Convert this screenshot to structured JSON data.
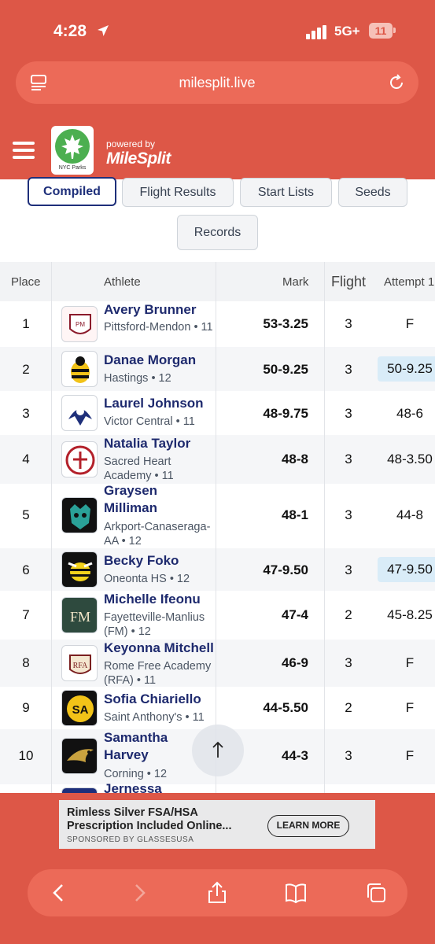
{
  "status": {
    "time": "4:28",
    "network": "5G+",
    "battery": "11"
  },
  "browser": {
    "url": "milesplit.live"
  },
  "site": {
    "logo_text": "NYC Parks",
    "powered_by": "powered by",
    "brand": "MileSplit"
  },
  "tabs": [
    {
      "label": "Compiled",
      "active": true
    },
    {
      "label": "Flight Results",
      "active": false
    },
    {
      "label": "Start Lists",
      "active": false
    },
    {
      "label": "Seeds",
      "active": false
    },
    {
      "label": "Records",
      "active": false
    }
  ],
  "table": {
    "headers": {
      "place": "Place",
      "athlete": "Athlete",
      "mark": "Mark",
      "flight": "Flight",
      "attempt": "Attempt 1"
    },
    "rows": [
      {
        "place": "1",
        "name": "Avery Brunner",
        "school": "Pittsford-Mendon • 11",
        "mark": "53-3.25",
        "flight": "3",
        "attempt": "F",
        "highlight": false
      },
      {
        "place": "2",
        "name": "Danae Morgan",
        "school": "Hastings • 12",
        "mark": "50-9.25",
        "flight": "3",
        "attempt": "50-9.25",
        "highlight": true
      },
      {
        "place": "3",
        "name": "Laurel Johnson",
        "school": "Victor Central • 11",
        "mark": "48-9.75",
        "flight": "3",
        "attempt": "48-6",
        "highlight": false
      },
      {
        "place": "4",
        "name": "Natalia Taylor",
        "school": "Sacred Heart Academy • 11",
        "mark": "48-8",
        "flight": "3",
        "attempt": "48-3.50",
        "highlight": false
      },
      {
        "place": "5",
        "name": "Graysen Milliman",
        "school": "Arkport-Canaseraga-AA • 12",
        "mark": "48-1",
        "flight": "3",
        "attempt": "44-8",
        "highlight": false
      },
      {
        "place": "6",
        "name": "Becky Foko",
        "school": "Oneonta HS • 12",
        "mark": "47-9.50",
        "flight": "3",
        "attempt": "47-9.50",
        "highlight": true
      },
      {
        "place": "7",
        "name": "Michelle Ifeonu",
        "school": "Fayetteville-Manlius (FM) • 12",
        "mark": "47-4",
        "flight": "2",
        "attempt": "45-8.25",
        "highlight": false
      },
      {
        "place": "8",
        "name": "Keyonna Mitchell",
        "school": "Rome Free Academy (RFA) • 11",
        "mark": "46-9",
        "flight": "3",
        "attempt": "F",
        "highlight": false
      },
      {
        "place": "9",
        "name": "Sofia Chiariello",
        "school": "Saint Anthony's • 11",
        "mark": "44-5.50",
        "flight": "2",
        "attempt": "F",
        "highlight": false
      },
      {
        "place": "10",
        "name": "Samantha Harvey",
        "school": "Corning • 12",
        "mark": "44-3",
        "flight": "3",
        "attempt": "F",
        "highlight": false
      },
      {
        "place": "",
        "name": "Jernessa",
        "school": "",
        "mark": "",
        "flight": "",
        "attempt": "",
        "highlight": false
      }
    ]
  },
  "ad": {
    "line1": "Rimless Silver FSA/HSA",
    "line2": "Prescription Included Online...",
    "sponsor": "SPONSORED BY GLASSESUSA",
    "cta": "LEARN MORE"
  },
  "colors": {
    "chrome": "#dd5747",
    "accent": "#1e2f7a",
    "highlight": "#d9ecf8"
  }
}
